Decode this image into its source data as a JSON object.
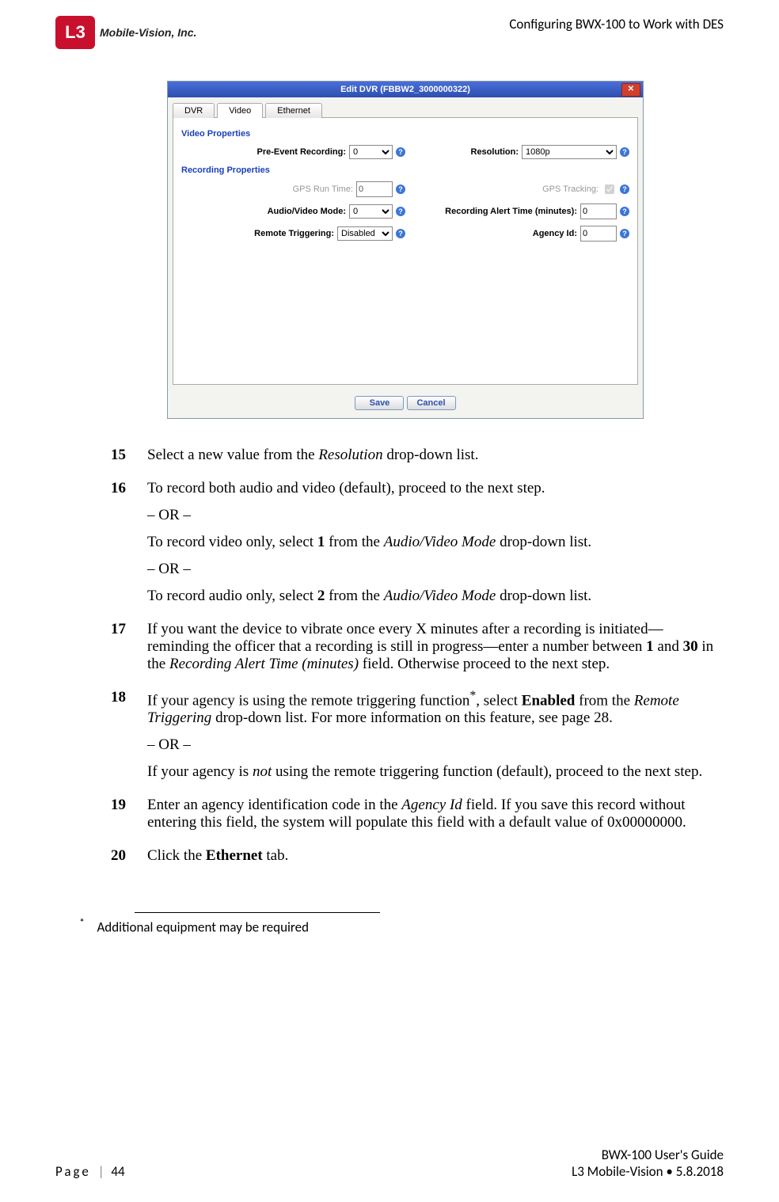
{
  "header": {
    "logo_mark": "L3",
    "logo_text": "Mobile-Vision, Inc.",
    "doc_section": "Configuring BWX-100 to Work with DES"
  },
  "dialog": {
    "title": "Edit DVR (FBBW2_3000000322)",
    "close": "✕",
    "tabs": {
      "dvr": "DVR",
      "video": "Video",
      "ethernet": "Ethernet"
    },
    "sections": {
      "video_props": "Video Properties",
      "recording_props": "Recording Properties"
    },
    "labels": {
      "pre_event": "Pre-Event Recording:",
      "resolution": "Resolution:",
      "gps_run": "GPS Run Time:",
      "gps_track": "GPS Tracking:",
      "av_mode": "Audio/Video Mode:",
      "alert_time": "Recording Alert Time (minutes):",
      "remote_trig": "Remote Triggering:",
      "agency_id": "Agency Id:"
    },
    "values": {
      "pre_event": "0",
      "resolution": "1080p",
      "gps_run": "0",
      "av_mode": "0",
      "alert_time": "0",
      "remote_trig": "Disabled",
      "agency_id": "0"
    },
    "buttons": {
      "save": "Save",
      "cancel": "Cancel"
    }
  },
  "steps": {
    "s15": {
      "num": "15",
      "t1a": "Select a new value from the ",
      "t1i": "Resolution",
      "t1b": " drop-down list."
    },
    "s16": {
      "num": "16",
      "p1": "To record both audio and video (default), proceed to the next step.",
      "or": "– OR –",
      "p2a": "To record video only, select ",
      "p2b": "1",
      "p2c": " from the ",
      "p2i": "Audio/Video Mode",
      "p2d": " drop-down list.",
      "p3a": "To record audio only, select ",
      "p3b": "2",
      "p3c": " from the ",
      "p3i": "Audio/Video Mode",
      "p3d": " drop-down list."
    },
    "s17": {
      "num": "17",
      "a": "If you want the device to vibrate once every X minutes after a recording is initiated—reminding the officer that a recording is still in progress—enter a number between ",
      "b1": "1",
      "mid": " and ",
      "b30": "30",
      "c": " in the ",
      "ci": "Recording Alert Time (minutes)",
      "d": " field. Otherwise proceed to the next step."
    },
    "s18": {
      "num": "18",
      "a": "If your agency is using the remote triggering function",
      "star": "*",
      "b": ", select ",
      "en": "Enabled",
      "c": " from the ",
      "ci": "Remote Triggering",
      "d": " drop-down list. For more information on this feature, see page 28.",
      "or": "– OR –",
      "e1": "If your agency is ",
      "not": "not",
      "e2": " using the remote triggering function (default), proceed to the next step."
    },
    "s19": {
      "num": "19",
      "a": "Enter an agency identification code in the ",
      "ai": "Agency Id",
      "b": " field. If you save this record without entering this field, the system will populate this field with a default value of 0x00000000."
    },
    "s20": {
      "num": "20",
      "a": "Click the ",
      "b": "Ethernet",
      "c": " tab."
    }
  },
  "footnote": {
    "star": "*",
    "text": "Additional equipment may be required"
  },
  "footer": {
    "page_label": "Page",
    "sep": "|",
    "page_num": "44",
    "guide": "BWX-100 User's Guide",
    "org": "L3 Mobile-Vision",
    "dot": "•",
    "date": "5.8.2018"
  }
}
